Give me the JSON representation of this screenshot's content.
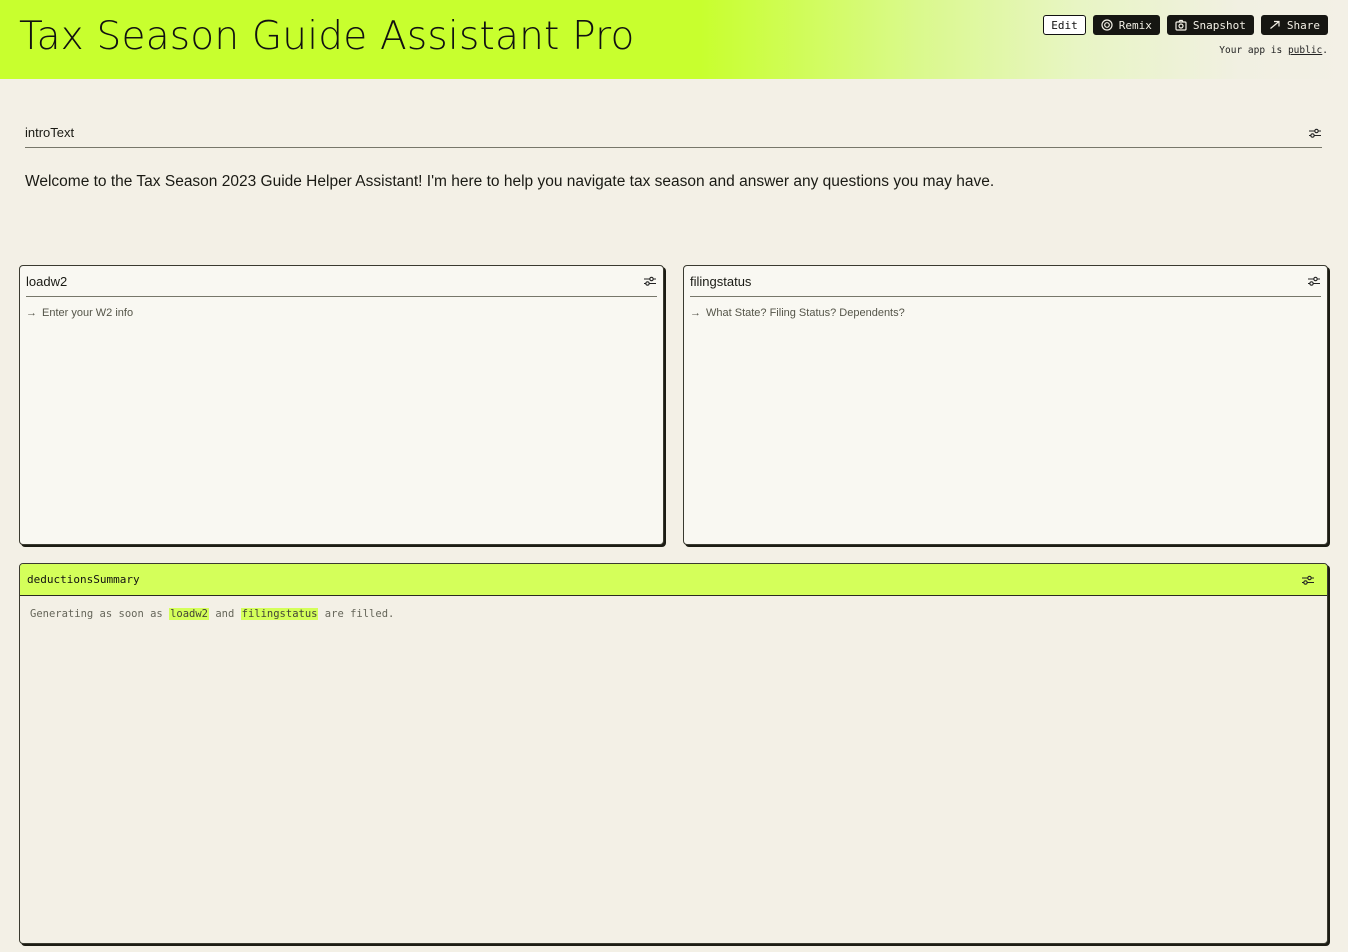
{
  "header": {
    "title": "Tax Season Guide Assistant Pro",
    "toolbar": {
      "edit_label": "Edit",
      "remix_label": "Remix",
      "snapshot_label": "Snapshot",
      "share_label": "Share"
    },
    "public_note": {
      "prefix": "Your app is ",
      "link": "public",
      "suffix": "."
    }
  },
  "intro": {
    "label": "introText",
    "text": "Welcome to the Tax Season 2023 Guide Helper Assistant! I'm here to help you navigate tax season and answer any questions you may have."
  },
  "inputs": [
    {
      "label": "loadw2",
      "placeholder": "Enter your W2 info"
    },
    {
      "label": "filingstatus",
      "placeholder": "What State? Filing Status? Dependents?"
    }
  ],
  "summary": {
    "label": "deductionsSummary",
    "text_parts": [
      "Generating as soon as ",
      "loadw2",
      " and ",
      "filingstatus",
      " are filled."
    ]
  },
  "colors": {
    "accent": "#c8ff2e",
    "summary_header": "#d4ff5a",
    "background": "#f3f0e6",
    "button_dark": "#161612"
  }
}
